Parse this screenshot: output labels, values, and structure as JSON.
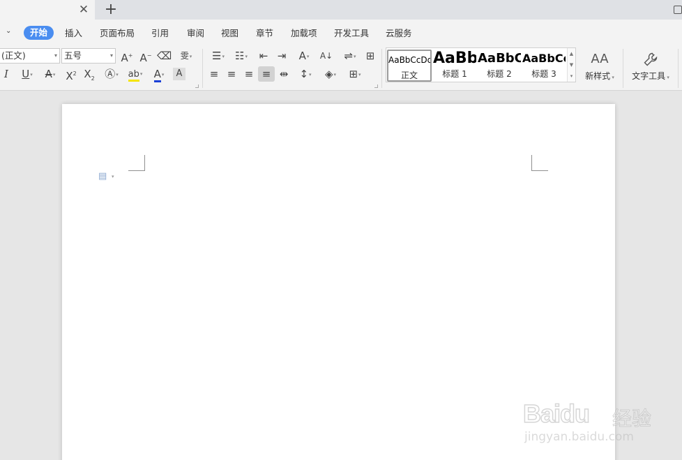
{
  "titlebar": {
    "close_glyph": "✕",
    "new_tab_glyph": "+"
  },
  "menu": {
    "chevron_glyph": "⌄",
    "items": [
      "开始",
      "插入",
      "页面布局",
      "引用",
      "审阅",
      "视图",
      "章节",
      "加载项",
      "开发工具",
      "云服务"
    ],
    "active": "开始",
    "active_color": "#4a8df0"
  },
  "ribbon": {
    "font_name": "(正文)",
    "font_size": "五号",
    "font_color_accent": "#1a3fd6",
    "highlight_accent": "#f5e400",
    "styles": [
      {
        "preview": "AaBbCcDd",
        "name": "正文"
      },
      {
        "preview": "AaBb",
        "name": "标题 1"
      },
      {
        "preview": "AaBbC",
        "name": "标题 2"
      },
      {
        "preview": "AaBbCc",
        "name": "标题 3"
      }
    ],
    "new_style_label": "新样式",
    "text_tools_label": "文字工具",
    "new_style_icon": "AA",
    "text_tools_icon": "wrench-icon"
  },
  "watermark": {
    "brand": "Baidu",
    "cn": "经验",
    "url": "jingyan.baidu.com"
  }
}
